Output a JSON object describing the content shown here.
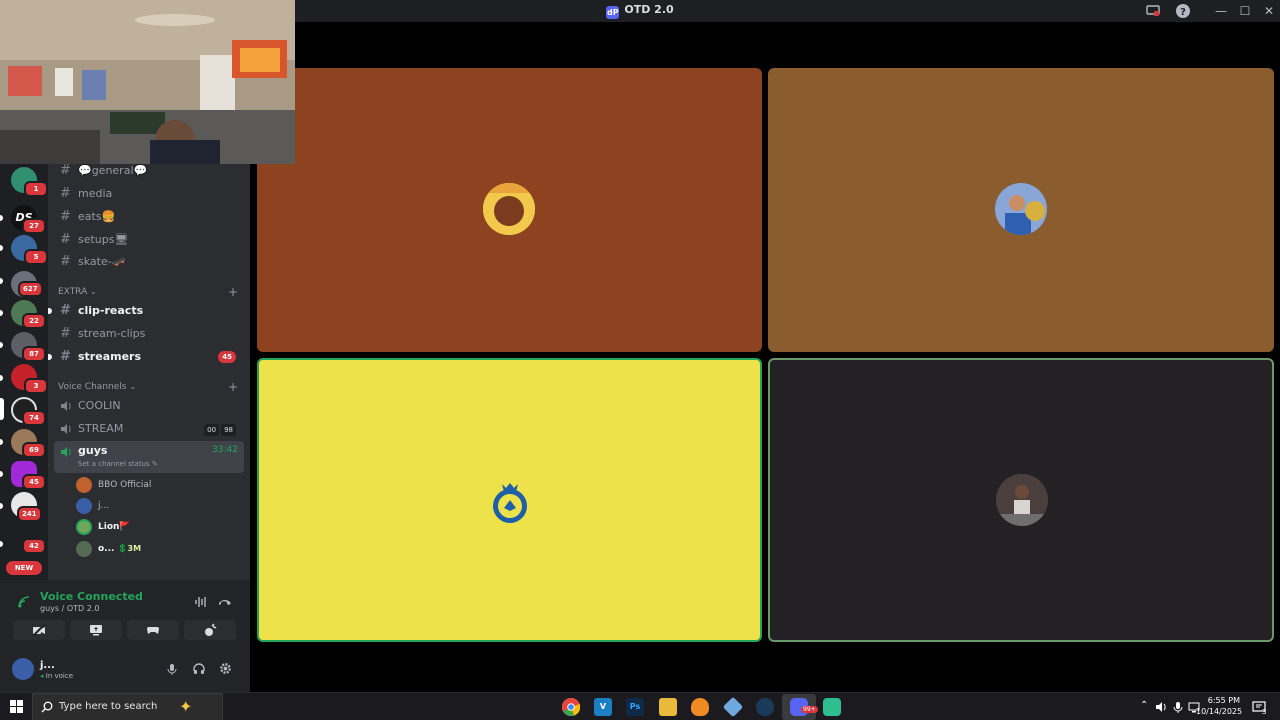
{
  "app": {
    "title": "OTD 2.0",
    "logo_text": "dP"
  },
  "window_controls": [
    "—",
    "☐",
    "✕"
  ],
  "servers": [
    {
      "badge": "1",
      "color": "#2f8f6e"
    },
    {
      "badge": "27",
      "color": "#111111",
      "label": "DS"
    },
    {
      "badge": "5",
      "color": "#3b6aa0"
    },
    {
      "badge": "627",
      "color": "#6b6f7a"
    },
    {
      "badge": "22",
      "color": "#4d7a54"
    },
    {
      "badge": "87",
      "color": "#5d5f66"
    },
    {
      "badge": "3",
      "color": "#c4212b"
    },
    {
      "badge": "74",
      "color": "#202020"
    },
    {
      "badge": "69",
      "color": "#9a7a5a"
    },
    {
      "badge": "45",
      "color": "#a02bd6"
    },
    {
      "badge": "241",
      "color": "#e8e8e8"
    },
    {
      "badge": "42",
      "color": "#2b2d31"
    }
  ],
  "new_label": "NEW",
  "text_channels": [
    {
      "name": "💬general💬",
      "bold": false
    },
    {
      "name": "media",
      "bold": false
    },
    {
      "name": "eats🍔",
      "bold": false
    },
    {
      "name": "setups🖥",
      "bold": false
    },
    {
      "name": "skate-🛹",
      "bold": false
    }
  ],
  "extra_category": {
    "label": "EXTRA",
    "channels": [
      {
        "name": "clip-reacts",
        "bold": true,
        "badge": ""
      },
      {
        "name": "stream-clips",
        "bold": false,
        "badge": ""
      },
      {
        "name": "streamers",
        "bold": true,
        "badge": "45"
      }
    ]
  },
  "voice_category": {
    "label": "Voice Channels",
    "channels": [
      {
        "name": "COOLIN",
        "counts": []
      },
      {
        "name": "STREAM",
        "counts": [
          "00",
          "98"
        ]
      }
    ],
    "active": {
      "name": "guys",
      "timer": "33:42",
      "status": "Set a channel status"
    },
    "members": [
      {
        "name": "BBO Official",
        "bold": false,
        "color": "#c0622e",
        "tag": ""
      },
      {
        "name": "j...",
        "bold": false,
        "color": "#3a5fa8",
        "tag": ""
      },
      {
        "name": "Lion",
        "bold": true,
        "color": "#6fa85a",
        "tag": "🚩"
      },
      {
        "name": "o...",
        "bold": true,
        "color": "#556b55",
        "tag": "💲3M"
      }
    ]
  },
  "voice_panel": {
    "status": "Voice Connected",
    "location": "guys / OTD 2.0"
  },
  "user_panel": {
    "name": "j...",
    "status": "In voice"
  },
  "tiles": [
    {
      "color": "#8e4320",
      "avatar_color": "#f2c94c",
      "speaking": false
    },
    {
      "color": "#8a5c2e",
      "avatar_color": "#3f6fb8",
      "speaking": false
    },
    {
      "color": "#ede24a",
      "avatar_color": "#ede24a",
      "speaking": true
    },
    {
      "color": "#232124",
      "avatar_color": "#5a4b45",
      "speaking": true
    }
  ],
  "taskbar": {
    "search_placeholder": "Type here to search",
    "time": "6:55 PM",
    "date": "10/14/2025",
    "notification_count": "3",
    "apps": [
      {
        "name": "Chrome",
        "label": "",
        "color": "#e8453c"
      },
      {
        "name": "Visual Studio",
        "label": "V",
        "color": "#1b7fc4"
      },
      {
        "name": "Photoshop",
        "label": "Ps",
        "color": "#0e2a47"
      },
      {
        "name": "File Explorer",
        "label": "",
        "color": "#e8b93a"
      },
      {
        "name": "FL Studio",
        "label": "",
        "color": "#f08a24"
      },
      {
        "name": "App",
        "label": "",
        "color": "#6fa8dc"
      },
      {
        "name": "Steam",
        "label": "",
        "color": "#1a3a5c"
      },
      {
        "name": "Discord",
        "label": "99+",
        "color": "#5865f2"
      },
      {
        "name": "App2",
        "label": "",
        "color": "#2fbf8f"
      }
    ]
  }
}
